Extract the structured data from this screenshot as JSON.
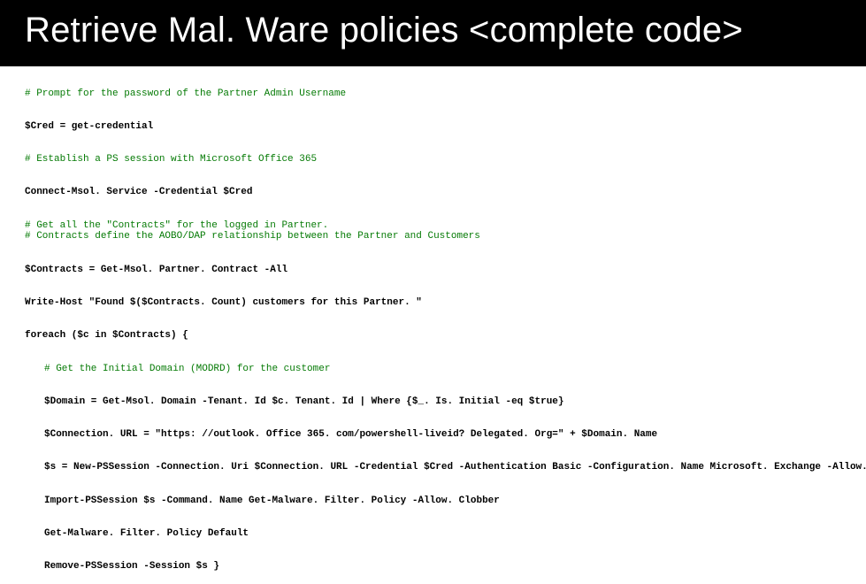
{
  "title": "Retrieve Mal. Ware policies <complete code>",
  "code": {
    "c1": "# Prompt for the password of the Partner Admin Username",
    "l1": "$Cred = get-credential",
    "c2": "# Establish a PS session with Microsoft Office 365",
    "l2": "Connect-Msol. Service -Credential $Cred",
    "c3a": "# Get all the \"Contracts\" for the logged in Partner.",
    "c3b": "# Contracts define the AOBO/DAP relationship between the Partner and Customers",
    "l3": "$Contracts = Get-Msol. Partner. Contract -All",
    "l4": "Write-Host \"Found $($Contracts. Count) customers for this Partner. \"",
    "l5": "foreach ($c in $Contracts) {",
    "c4": "# Get the Initial Domain (MODRD) for the customer",
    "l6": "$Domain = Get-Msol. Domain -Tenant. Id $c. Tenant. Id | Where {$_. Is. Initial -eq $true}",
    "l7": "$Connection. URL = \"https: //outlook. Office 365. com/powershell-liveid? Delegated. Org=\" + $Domain. Name",
    "l8": "$s = New-PSSession -Connection. Uri $Connection. URL -Credential $Cred -Authentication Basic -Configuration. Name Microsoft. Exchange -Allow. Redirection",
    "l9": "Import-PSSession $s -Command. Name Get-Malware. Filter. Policy -Allow. Clobber",
    "l10": "Get-Malware. Filter. Policy Default",
    "l11": "Remove-PSSession -Session $s }"
  }
}
